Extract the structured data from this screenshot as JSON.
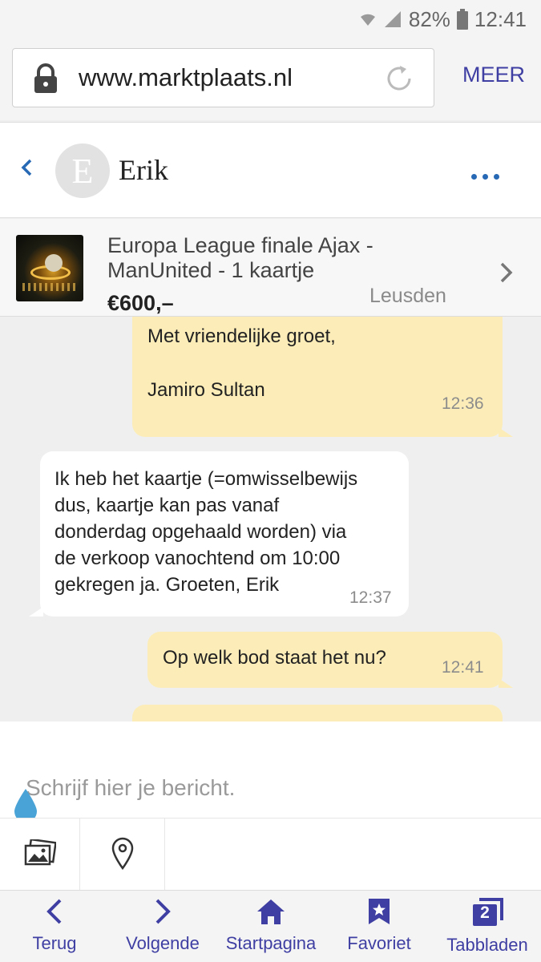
{
  "status_bar": {
    "battery": "82%",
    "time": "12:41"
  },
  "browser": {
    "url": "www.marktplaats.nl",
    "menu_label": "MEER"
  },
  "chat_header": {
    "avatar_letter": "E",
    "contact_name": "Erik"
  },
  "listing": {
    "title": "Europa League finale Ajax - ManUnited - 1 kaartje",
    "price": "€600,–",
    "location": "Leusden"
  },
  "messages": [
    {
      "direction": "outgoing",
      "lines": [
        "Met vriendelijke groet,",
        "",
        "Jamiro Sultan"
      ],
      "time": "12:36"
    },
    {
      "direction": "incoming",
      "lines": [
        "Ik heb het kaartje (=omwisselbewijs",
        "dus, kaartje kan pas vanaf",
        "donderdag opgehaald worden) via",
        "de verkoop vanochtend om 10:00",
        "gekregen ja. Groeten, Erik"
      ],
      "time": "12:37"
    },
    {
      "direction": "outgoing",
      "lines": [
        "Op welk bod staat het nu?"
      ],
      "time": "12:41"
    }
  ],
  "composer": {
    "placeholder": "Schrijf hier je bericht."
  },
  "attach_icons": [
    "image-icon",
    "location-pin-icon"
  ],
  "bottom_nav": [
    {
      "label": "Terug",
      "icon": "chevron-left-icon"
    },
    {
      "label": "Volgende",
      "icon": "chevron-right-icon"
    },
    {
      "label": "Startpagina",
      "icon": "home-icon"
    },
    {
      "label": "Favoriet",
      "icon": "bookmark-star-icon"
    },
    {
      "label": "Tabbladen",
      "icon": "tabs-icon",
      "badge": "2"
    }
  ],
  "colors": {
    "accent": "#3f3fa3",
    "outgoing_bubble": "#fcedb8",
    "incoming_bubble": "#ffffff",
    "link_blue": "#2769b4"
  }
}
